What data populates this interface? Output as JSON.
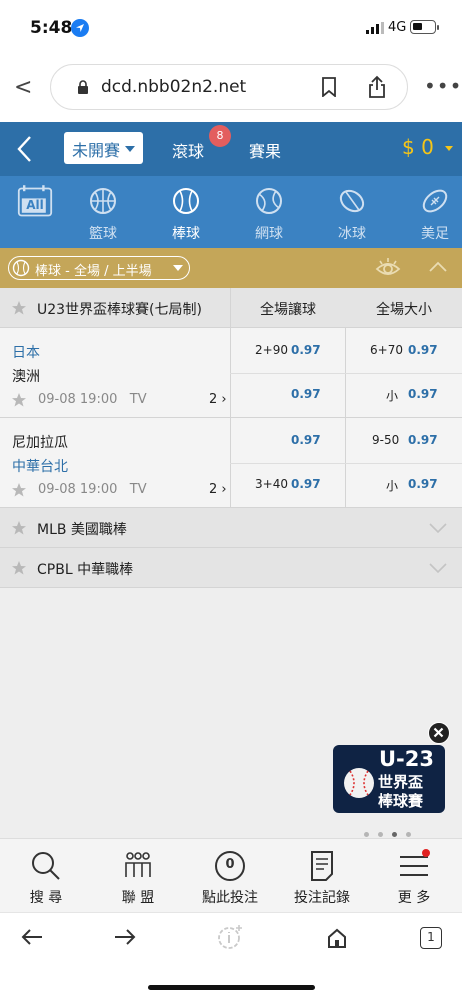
{
  "status": {
    "time": "5:48",
    "network": "4G"
  },
  "browser": {
    "url": "dcd.nbb02n2.net"
  },
  "header": {
    "market_select": "未開賽",
    "live_label": "滾球",
    "live_count": "8",
    "results_label": "賽果",
    "balance": "$ 0"
  },
  "sports": [
    {
      "label": "All",
      "icon": "calendar-all-icon"
    },
    {
      "label": "籃球",
      "icon": "basketball-icon"
    },
    {
      "label": "棒球",
      "icon": "baseball-icon",
      "active": true
    },
    {
      "label": "網球",
      "icon": "tennis-icon"
    },
    {
      "label": "冰球",
      "icon": "hockey-icon"
    },
    {
      "label": "美足",
      "icon": "football-icon"
    }
  ],
  "filter": {
    "label": "棒球 - 全場 / 上半場"
  },
  "league": {
    "title": "U23世界盃棒球賽(七局制)",
    "col_handicap": "全場讓球",
    "col_total": "全場大小"
  },
  "matches": [
    {
      "home": "日本",
      "away": "澳洲",
      "time": "09-08 19:00",
      "tv": "TV",
      "more": "2",
      "handicap": [
        {
          "line": "2+90",
          "odds": "0.97"
        },
        {
          "line": "",
          "odds": "0.97"
        }
      ],
      "total": [
        {
          "line": "6+70",
          "odds": "0.97"
        },
        {
          "line": "小",
          "odds": "0.97"
        }
      ]
    },
    {
      "home": "尼加拉瓜",
      "away": "中華台北",
      "time": "09-08 19:00",
      "tv": "TV",
      "more": "2",
      "handicap": [
        {
          "line": "",
          "odds": "0.97"
        },
        {
          "line": "3+40",
          "odds": "0.97"
        }
      ],
      "total": [
        {
          "line": "9-50",
          "odds": "0.97"
        },
        {
          "line": "小",
          "odds": "0.97"
        }
      ]
    }
  ],
  "other_leagues": [
    "MLB 美國職棒",
    "CPBL 中華職棒"
  ],
  "promo": {
    "line1": "U-23",
    "line2": "世界盃",
    "line3": "棒球賽"
  },
  "bottom_nav": [
    "搜 尋",
    "聯 盟",
    "點此投注",
    "投注記錄",
    "更 多"
  ],
  "bet_count": "0",
  "tab_count": "1",
  "colors": {
    "header": "#2d6fa8",
    "sports_bar": "#3b82c2",
    "filter_bar": "#c4a659",
    "balance": "#f5c518",
    "badge": "#e35e5e"
  }
}
